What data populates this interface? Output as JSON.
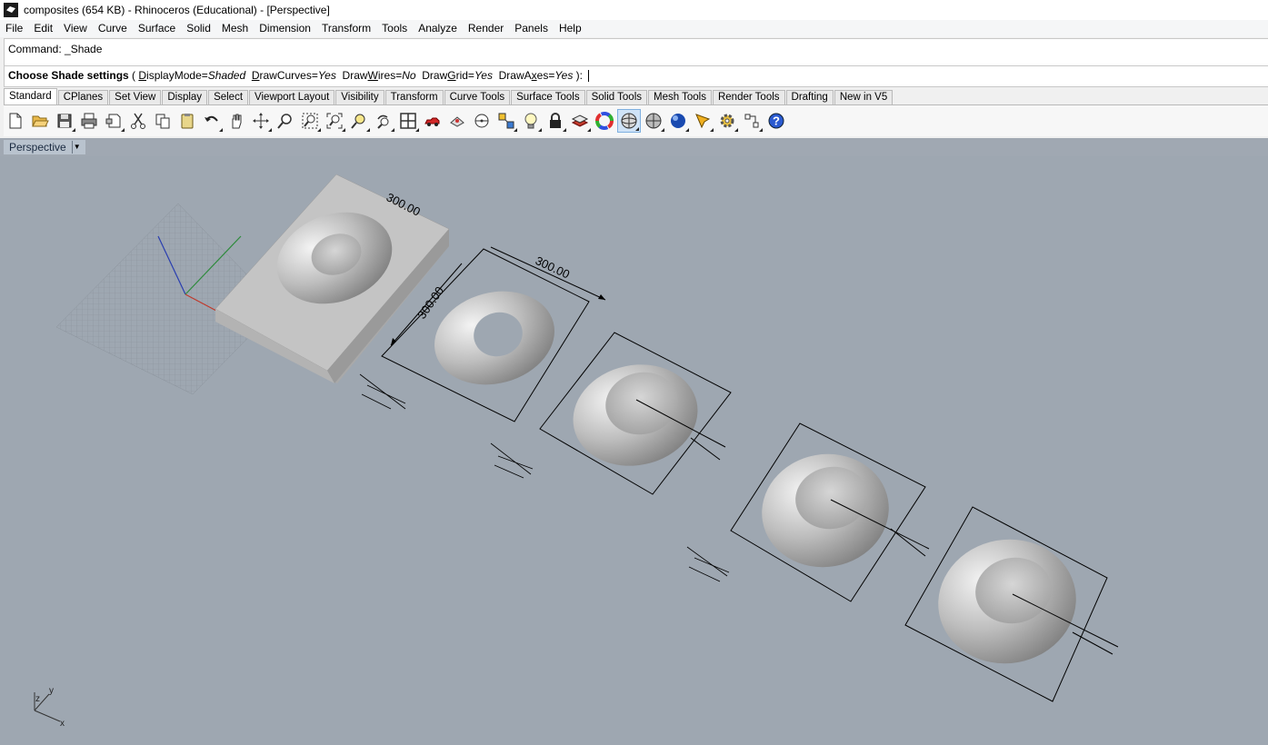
{
  "window": {
    "title": "composites (654 KB) - Rhinoceros (Educational) - [Perspective]"
  },
  "menu": [
    "File",
    "Edit",
    "View",
    "Curve",
    "Surface",
    "Solid",
    "Mesh",
    "Dimension",
    "Transform",
    "Tools",
    "Analyze",
    "Render",
    "Panels",
    "Help"
  ],
  "command": {
    "history": "Command: _Shade",
    "prompt_label": "Choose Shade settings",
    "open": " ( ",
    "opt1_key": "D",
    "opt1_rest": "isplayMode=",
    "opt1_val": "Shaded",
    "opt2_key": "D",
    "opt2_rest": "rawCurves=",
    "opt2_val": "Yes",
    "opt3_key": "W",
    "opt3_pre": "Draw",
    "opt3_rest": "ires=",
    "opt3_val": "No",
    "opt4_pre": "Draw",
    "opt4_key": "G",
    "opt4_rest": "rid=",
    "opt4_val": "Yes",
    "opt5_pre": "DrawA",
    "opt5_key": "x",
    "opt5_rest": "es=",
    "opt5_val": "Yes",
    "close": " ): "
  },
  "tabs": [
    "Standard",
    "CPlanes",
    "Set View",
    "Display",
    "Select",
    "Viewport Layout",
    "Visibility",
    "Transform",
    "Curve Tools",
    "Surface Tools",
    "Solid Tools",
    "Mesh Tools",
    "Render Tools",
    "Drafting",
    "New in V5"
  ],
  "tools": [
    "new-icon",
    "open-icon",
    "save-icon",
    "print-icon",
    "import-icon",
    "cut-icon",
    "copy-icon",
    "paste-icon",
    "undo-icon",
    "pan-icon",
    "rotate-view-icon",
    "zoom-dynamic-icon",
    "zoom-window-icon",
    "zoom-extents-icon",
    "zoom-selected-icon",
    "undo-view-icon",
    "four-viewports-icon",
    "car-icon",
    "properties-icon",
    "point-icon",
    "grid-snap-icon",
    "light-icon",
    "lock-icon",
    "layer-icon",
    "color-wheel-icon",
    "shade-icon",
    "rendered-icon",
    "render-sphere-icon",
    "render-tools-icon",
    "options-gear-icon",
    "dimension-icon",
    "help-icon"
  ],
  "viewport": {
    "name": "Perspective",
    "dimensions": [
      "300.00",
      "300.00",
      "300.00"
    ],
    "axis_labels": {
      "z": "z",
      "y": "y",
      "x": "x"
    },
    "colors": {
      "background": "#9ea7b1",
      "x_axis": "#c0392b",
      "y_axis": "#2e8b3c",
      "z_axis": "#2a3fb0"
    }
  }
}
